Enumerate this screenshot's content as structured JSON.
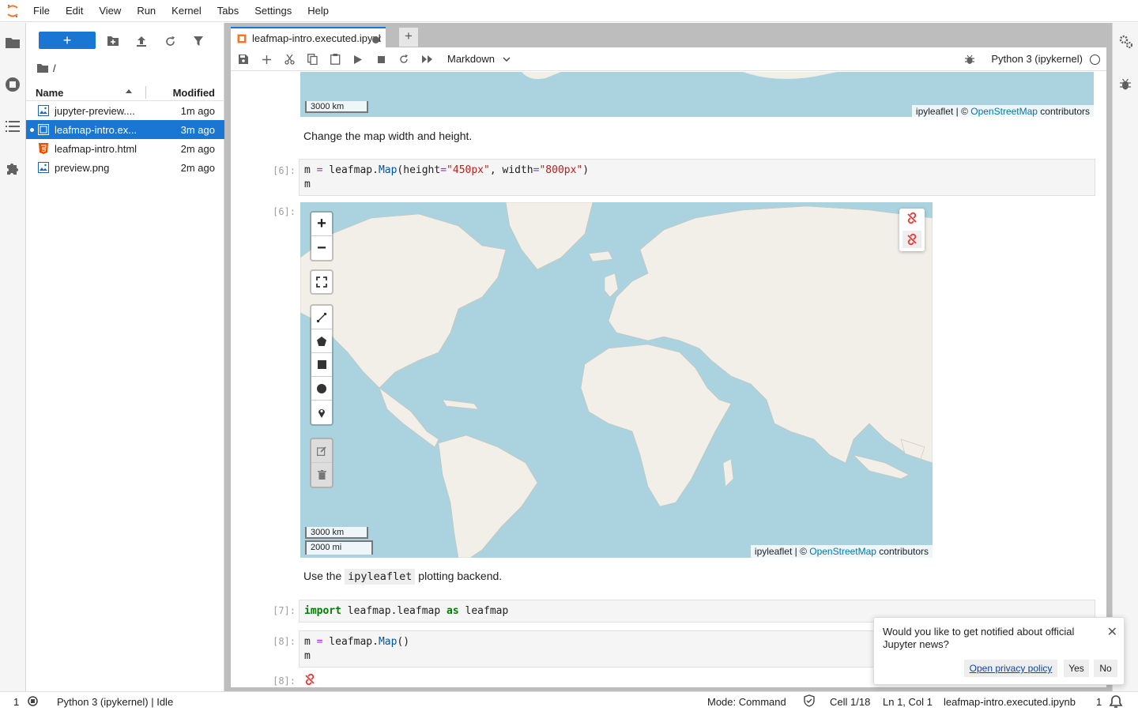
{
  "menubar": {
    "items": [
      "File",
      "Edit",
      "View",
      "Run",
      "Kernel",
      "Tabs",
      "Settings",
      "Help"
    ]
  },
  "file_browser": {
    "new_button": "+",
    "breadcrumb": "/",
    "columns": {
      "name": "Name",
      "modified": "Modified"
    },
    "files": [
      {
        "name": "jupyter-preview....",
        "modified": "1m ago",
        "icon": "image-file-icon",
        "selected": false
      },
      {
        "name": "leafmap-intro.ex...",
        "modified": "3m ago",
        "icon": "notebook-file-icon",
        "selected": true
      },
      {
        "name": "leafmap-intro.html",
        "modified": "2m ago",
        "icon": "html-file-icon",
        "selected": false
      },
      {
        "name": "preview.png",
        "modified": "2m ago",
        "icon": "image-file-icon",
        "selected": false
      }
    ]
  },
  "tabs": {
    "active_tab": "leafmap-intro.executed.ipynb",
    "add_tab": "+"
  },
  "notebook_toolbar": {
    "cell_type": "Markdown",
    "kernel": "Python 3 (ipykernel)"
  },
  "cells": {
    "top_map": {
      "scale_km": "3000 km",
      "attribution_prefix": "ipyleaflet | © ",
      "attribution_link": "OpenStreetMap",
      "attribution_suffix": " contributors"
    },
    "md1": "Change the map width and height.",
    "code6_prompt": "[6]:",
    "out6_prompt": "[6]:",
    "map6": {
      "scale_km": "3000 km",
      "scale_mi": "2000 mi",
      "attribution_prefix": "ipyleaflet | © ",
      "attribution_link": "OpenStreetMap",
      "attribution_suffix": " contributors",
      "zoom_in": "+",
      "zoom_out": "−"
    },
    "md2_prefix": "Use the ",
    "md2_code": "ipyleaflet",
    "md2_suffix": " plotting backend.",
    "code7_prompt": "[7]:",
    "code8_prompt": "[8]:",
    "out8_prompt": "[8]:"
  },
  "statusbar": {
    "terminals": "1",
    "kernel_status": "Python 3 (ipykernel) | Idle",
    "mode": "Mode: Command",
    "cell": "Cell 1/18",
    "cursor": "Ln 1, Col 1",
    "file": "leafmap-intro.executed.ipynb",
    "notifications": "1"
  },
  "notification": {
    "message": "Would you like to get notified about official Jupyter news?",
    "privacy": "Open privacy policy",
    "yes": "Yes",
    "no": "No"
  },
  "colors": {
    "accent": "#1976d2",
    "water": "#aad3df",
    "land": "#f2efe9"
  }
}
